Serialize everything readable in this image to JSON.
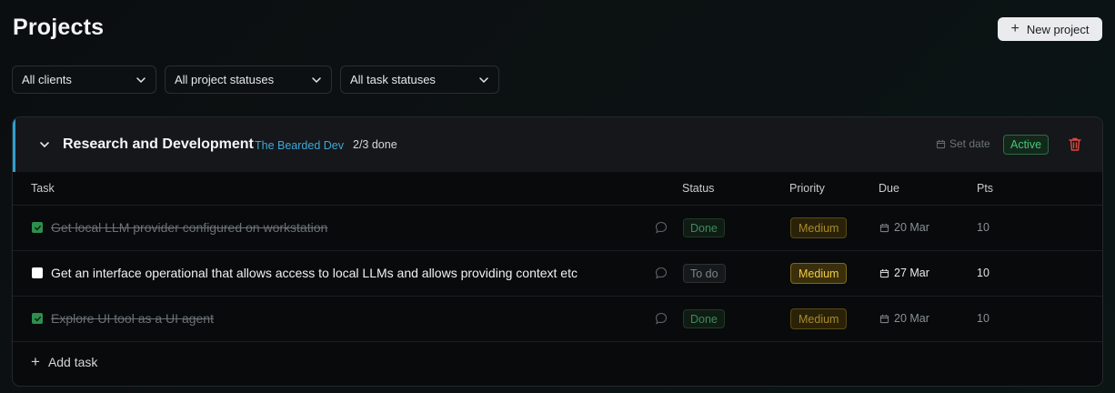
{
  "header": {
    "title": "Projects",
    "new_project_label": "New project"
  },
  "filters": [
    {
      "label": "All clients"
    },
    {
      "label": "All project statuses"
    },
    {
      "label": "All task statuses"
    }
  ],
  "project": {
    "name": "Research and Development",
    "client": "The Bearded Dev",
    "progress": "2/3 done",
    "set_date_label": "Set date",
    "status": "Active",
    "accent_color": "#2f9fd0"
  },
  "table": {
    "columns": {
      "task": "Task",
      "status": "Status",
      "priority": "Priority",
      "due": "Due",
      "pts": "Pts"
    },
    "rows": [
      {
        "title": "Get local LLM provider configured on workstation",
        "done": true,
        "status": "Done",
        "priority": "Medium",
        "due": "20 Mar",
        "pts": "10"
      },
      {
        "title": "Get an interface operational that allows access to local LLMs and allows providing context etc",
        "done": false,
        "status": "To do",
        "priority": "Medium",
        "due": "27 Mar",
        "pts": "10"
      },
      {
        "title": "Explore UI tool as a UI agent",
        "done": true,
        "status": "Done",
        "priority": "Medium",
        "due": "20 Mar",
        "pts": "10"
      }
    ]
  },
  "add_task_label": "Add task",
  "icons": {
    "new_project": "plus-icon",
    "filter": "chevron-down-icon",
    "collapse": "chevron-down-icon",
    "date": "calendar-icon",
    "delete": "trash-icon",
    "comment": "comment-icon",
    "checkbox": "checkbox-icon",
    "add_task": "plus-icon"
  }
}
